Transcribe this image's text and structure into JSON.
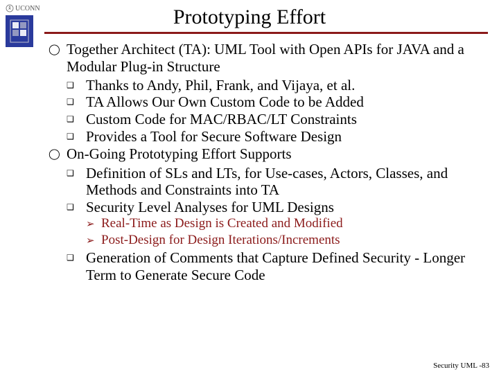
{
  "logo": {
    "text": "UCONN"
  },
  "title": "Prototyping Effort",
  "bullets": [
    {
      "text": "Together Architect (TA): UML Tool with Open APIs for JAVA and a Modular Plug-in Structure",
      "sub": [
        {
          "text": "Thanks to Andy, Phil, Frank, and Vijaya, et al."
        },
        {
          "text": "TA Allows Our Own Custom Code to be Added"
        },
        {
          "text": "Custom Code for MAC/RBAC/LT Constraints"
        },
        {
          "text": "Provides a Tool for Secure Software Design"
        }
      ]
    },
    {
      "text": "On-Going Prototyping Effort Supports",
      "sub": [
        {
          "text": "Definition of SLs and LTs, for Use-cases, Actors, Classes, and Methods and Constraints into TA"
        },
        {
          "text": "Security Level Analyses for UML Designs",
          "sub3": [
            {
              "text": "Real-Time as Design is Created and Modified"
            },
            {
              "text": "Post-Design for Design Iterations/Increments"
            }
          ]
        },
        {
          "text": "Generation of Comments that Capture Defined Security - Longer Term to Generate Secure Code"
        }
      ]
    }
  ],
  "footer": "Security UML -83"
}
